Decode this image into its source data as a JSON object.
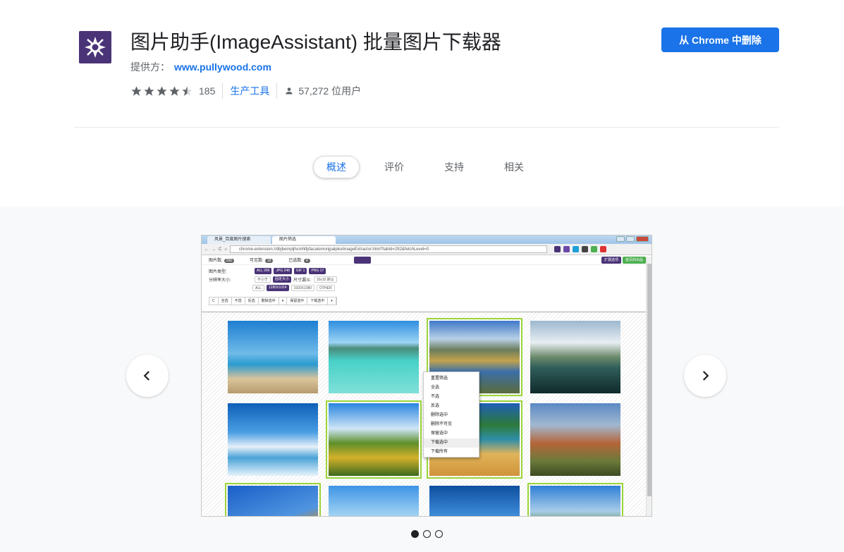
{
  "extension": {
    "title": "图片助手(ImageAssistant) 批量图片下载器",
    "provider_label": "提供方：",
    "provider_link": "www.pullywood.com",
    "rating_count": "185",
    "rating_value": 4.5,
    "category": "生产工具",
    "users": "57,272 位用户",
    "remove_button": "从 Chrome 中删除"
  },
  "tabs": [
    {
      "label": "概述",
      "active": true
    },
    {
      "label": "评价",
      "active": false
    },
    {
      "label": "支持",
      "active": false
    },
    {
      "label": "相关",
      "active": false
    }
  ],
  "carousel": {
    "current_slide": 1,
    "total_slides": 3
  },
  "screenshot": {
    "browser_tabs": [
      "风景_百度图片搜索",
      "图片筛选"
    ],
    "url": "chrome-extension://dbjbempljhcmhlfpfacalomonjpalpko/imageExtractor.html?tabId=292&fetchLevel=0",
    "window_label": "Rayslaw",
    "counts": {
      "img_count_label": "图片数:",
      "img_count": "266",
      "visible_label": "可见数:",
      "visible_count": "18",
      "selected_label": "已选数:",
      "selected_count": "4"
    },
    "top_right_buttons": [
      "扩展选项",
      "首页的出品"
    ],
    "type_label": "图片类型:",
    "types": [
      {
        "label": "ALL",
        "count": "266"
      },
      {
        "label": "JPG",
        "count": "248"
      },
      {
        "label": "GIF",
        "count": "1"
      },
      {
        "label": "PNG",
        "count": "17"
      }
    ],
    "size_label": "分辨率大小:",
    "size_opts": [
      "不小于",
      "固定大小"
    ],
    "size_filter_label": "尺寸漏斗:",
    "size_filter_value": "10x10 默认",
    "resolutions": [
      "ALL",
      "1280X1024",
      "1920X1080",
      "OTHER"
    ],
    "actions": [
      "C",
      "全选",
      "不选",
      "反选",
      "删除选中",
      "▾",
      "保留选中",
      "下载选中",
      "▾"
    ],
    "context_menu": [
      "重置筛选",
      "全选",
      "不选",
      "反选",
      "删除选中",
      "删除不可见",
      "保留选中",
      "下载选中",
      "下载所有"
    ]
  },
  "colors": {
    "accent": "#1a73e8",
    "logo_bg": "#4a3477",
    "selected_outline": "#9bd53a",
    "page_gray": "#f8f9fa"
  }
}
